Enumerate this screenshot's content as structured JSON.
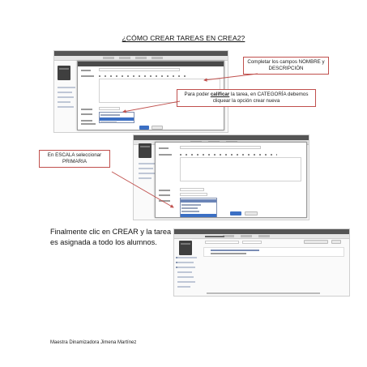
{
  "document": {
    "title": "¿CÓMO CREAR TAREAS EN CREA2?",
    "callouts": {
      "fields": "Completar los campos NOMBRE y DESCRIPCIÓN",
      "grade_pre": "Para poder ",
      "grade_emph": "calificar",
      "grade_post": " la tarea, en CATEGORÍA debemos cliquear la opción crear nueva",
      "scale": "En ESCALA seleccionar PRIMARIA"
    },
    "final_text": "Finalmente clic en CREAR y la tarea es asignada a todo los alumnos.",
    "footer": "Maestra Dinamizadora  Jimena Martínez"
  },
  "colors": {
    "callout_border": "#c0504d",
    "arrow": "#c0504d",
    "accent_blue": "#3b6fc4"
  }
}
